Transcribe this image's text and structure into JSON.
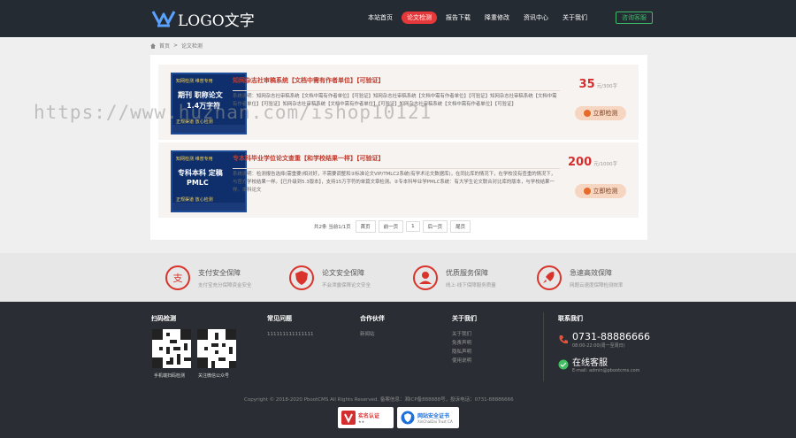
{
  "header": {
    "logo_text": "LOGO文字",
    "nav": [
      "本站首页",
      "论文检测",
      "报告下载",
      "降重修改",
      "资讯中心",
      "关于我们"
    ],
    "active_index": 1,
    "consult_label": "咨询客服"
  },
  "breadcrumb": {
    "home": "首页",
    "separator": ">",
    "current": "论文检测"
  },
  "items": [
    {
      "thumb": {
        "line1": "知网检测 维普专用",
        "line2": "期刊 职称论文",
        "line3": "1.4万字符",
        "line4": "正规渠道 放心检测"
      },
      "title": "知网杂志社审稿系统【文档中需有作者单位】【可验证】",
      "desc": "系统说明：知网杂志社审稿系统【文档中需有作者单位】【可验证】知网杂志社审稿系统【文档中需有作者单位】【可验证】知网杂志社审稿系统【文档中需有作者单位】【可验证】知网杂志社审稿系统【文档中需有作者单位】【可验证】知网杂志社审稿系统【文档中需有作者单位】【可验证】",
      "price": "35",
      "unit": "元/300字",
      "button": "立即检测"
    },
    {
      "thumb": {
        "line1": "知网检测 维普专用",
        "line2": "专科本科 定稿",
        "line3": "PMLC",
        "line4": "正规渠道 放心检测"
      },
      "title": "专本科毕业学位论文查重【和学校结果一样】【可验证】",
      "desc": "系统说明：检测报告选择(需重要)相对好，不需要调整和②标准论文VIP/TMLC2系统(有学术论文数据库)，在同比库的情况下，在学校没有查重的情况下，与官方学校结果一样。【已升级到5.3版本】，支持15万字符的单篇文章检测。②专本科毕业学PMLC系统：有大学生论文联合对比库的版本，与学校结果一样。本科论文",
      "price": "200",
      "unit": "元/1000字",
      "button": "立即检测"
    }
  ],
  "pager": {
    "info": "共2条 当前1/1页",
    "buttons": [
      "首页",
      "前一页",
      "1",
      "后一页",
      "尾页"
    ]
  },
  "features": [
    {
      "icon": "pay-icon",
      "title": "支付安全保障",
      "sub": "支付宝充分保障资金安全"
    },
    {
      "icon": "shield-icon",
      "title": "论文安全保障",
      "sub": "不会泄露保障论文安全"
    },
    {
      "icon": "service-icon",
      "title": "优质服务保障",
      "sub": "线上·线下保障服务质量"
    },
    {
      "icon": "rocket-icon",
      "title": "急速高效保障",
      "sub": "网题云速度保障检测效率"
    }
  ],
  "footer": {
    "qr_title": "扫码检测",
    "qr_labels": [
      "手机端扫码检测",
      "关注微信公众号"
    ],
    "faq_title": "常见问题",
    "faq_items": [
      "111111111111111"
    ],
    "partner_title": "合作伙伴",
    "partner_items": [
      "新闻站"
    ],
    "about_title": "关于我们",
    "about_items": [
      "关于我们",
      "免责声明",
      "隐私声明",
      "使用说明"
    ],
    "contact_title": "联系我们",
    "phone": "0731-88886666",
    "phone_hours": "08:00-22:00(周一至周日)",
    "service_label": "在线客服",
    "email": "E-mail: admin@pbootcms.com",
    "copyright": "Copyright © 2018-2020 PbootCMS All Rights Reserved. 备案信息：湘ICP备888888号，投诉电话：0731-88886666",
    "badges": [
      {
        "title": "实名认证",
        "sub": "★★",
        "color": "#d32f2f"
      },
      {
        "title": "网站安全证书",
        "sub": "XinChaiDai Trust CA",
        "color": "#1e6fd8"
      }
    ]
  },
  "watermark": "https://www.huzhan.com/ishop10121"
}
